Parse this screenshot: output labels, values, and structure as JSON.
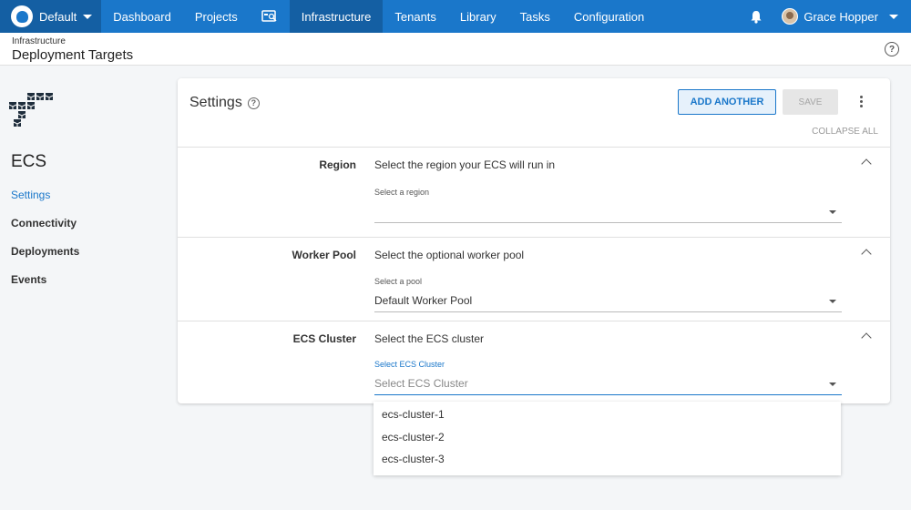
{
  "topnav": {
    "space": "Default",
    "items": [
      "Dashboard",
      "Projects",
      "Infrastructure",
      "Tenants",
      "Library",
      "Tasks",
      "Configuration"
    ],
    "active": "Infrastructure",
    "user": "Grace Hopper",
    "brand_color": "#1a77ca"
  },
  "header": {
    "breadcrumb": "Infrastructure",
    "title": "Deployment Targets",
    "help": "?"
  },
  "sidebar": {
    "title": "ECS",
    "items": [
      "Settings",
      "Connectivity",
      "Deployments",
      "Events"
    ],
    "active": "Settings"
  },
  "card": {
    "title": "Settings",
    "help": "?",
    "add_label": "ADD ANOTHER",
    "save_label": "SAVE",
    "collapse_label": "COLLAPSE ALL",
    "sections": [
      {
        "label": "Region",
        "description": "Select the region your ECS will run in",
        "field_label": "Select a region",
        "value": ""
      },
      {
        "label": "Worker Pool",
        "description": "Select the optional worker pool",
        "field_label": "Select a pool",
        "value": "Default Worker Pool"
      },
      {
        "label": "ECS Cluster",
        "description": "Select the ECS cluster",
        "field_label": "Select ECS Cluster",
        "placeholder": "Select ECS Cluster"
      }
    ]
  },
  "dropdown": {
    "options": [
      "ecs-cluster-1",
      "ecs-cluster-2",
      "ecs-cluster-3"
    ]
  }
}
